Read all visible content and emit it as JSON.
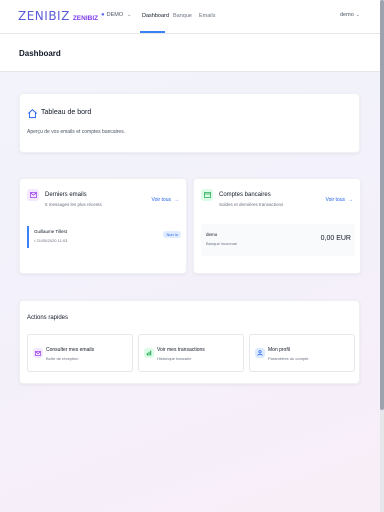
{
  "nav": {
    "logo": "ZENIBIZ",
    "logo_sub": "ZENIBIZ",
    "company": "DEMO",
    "links": [
      "Dashboard",
      "Banque",
      "Emails"
    ],
    "user": "demo"
  },
  "page": {
    "title": "Dashboard"
  },
  "hero": {
    "title": "Tableau de bord",
    "description": "Aperçu de vos emails et comptes bancaires."
  },
  "emails": {
    "title": "Derniers emails",
    "subtitle": "5 messages les plus récents",
    "see_all": "Voir tous",
    "item": {
      "from": "Guillaume Tillest",
      "date": "• 21/05/2020 11:03",
      "badge": "Non lu"
    }
  },
  "bank": {
    "title": "Comptes bancaires",
    "subtitle": "Soldes et dernières transactions",
    "see_all": "Voir tous",
    "account": {
      "name": "demo",
      "bank": "Banque inconnue",
      "balance": "0,00 EUR"
    }
  },
  "actions": {
    "title": "Actions rapides",
    "items": [
      {
        "label": "Consulter mes emails",
        "sub": "Boîte de réception",
        "icon": "envelope-icon"
      },
      {
        "label": "Voir mes transactions",
        "sub": "Historique bancaire",
        "icon": "chart-icon"
      },
      {
        "label": "Mon profil",
        "sub": "Paramètres du compte",
        "icon": "user-icon"
      }
    ]
  },
  "colors": {
    "accent": "#3b82f6",
    "brand": "#5b5bd6",
    "purple": "#9333ea",
    "green": "#16a34a"
  }
}
